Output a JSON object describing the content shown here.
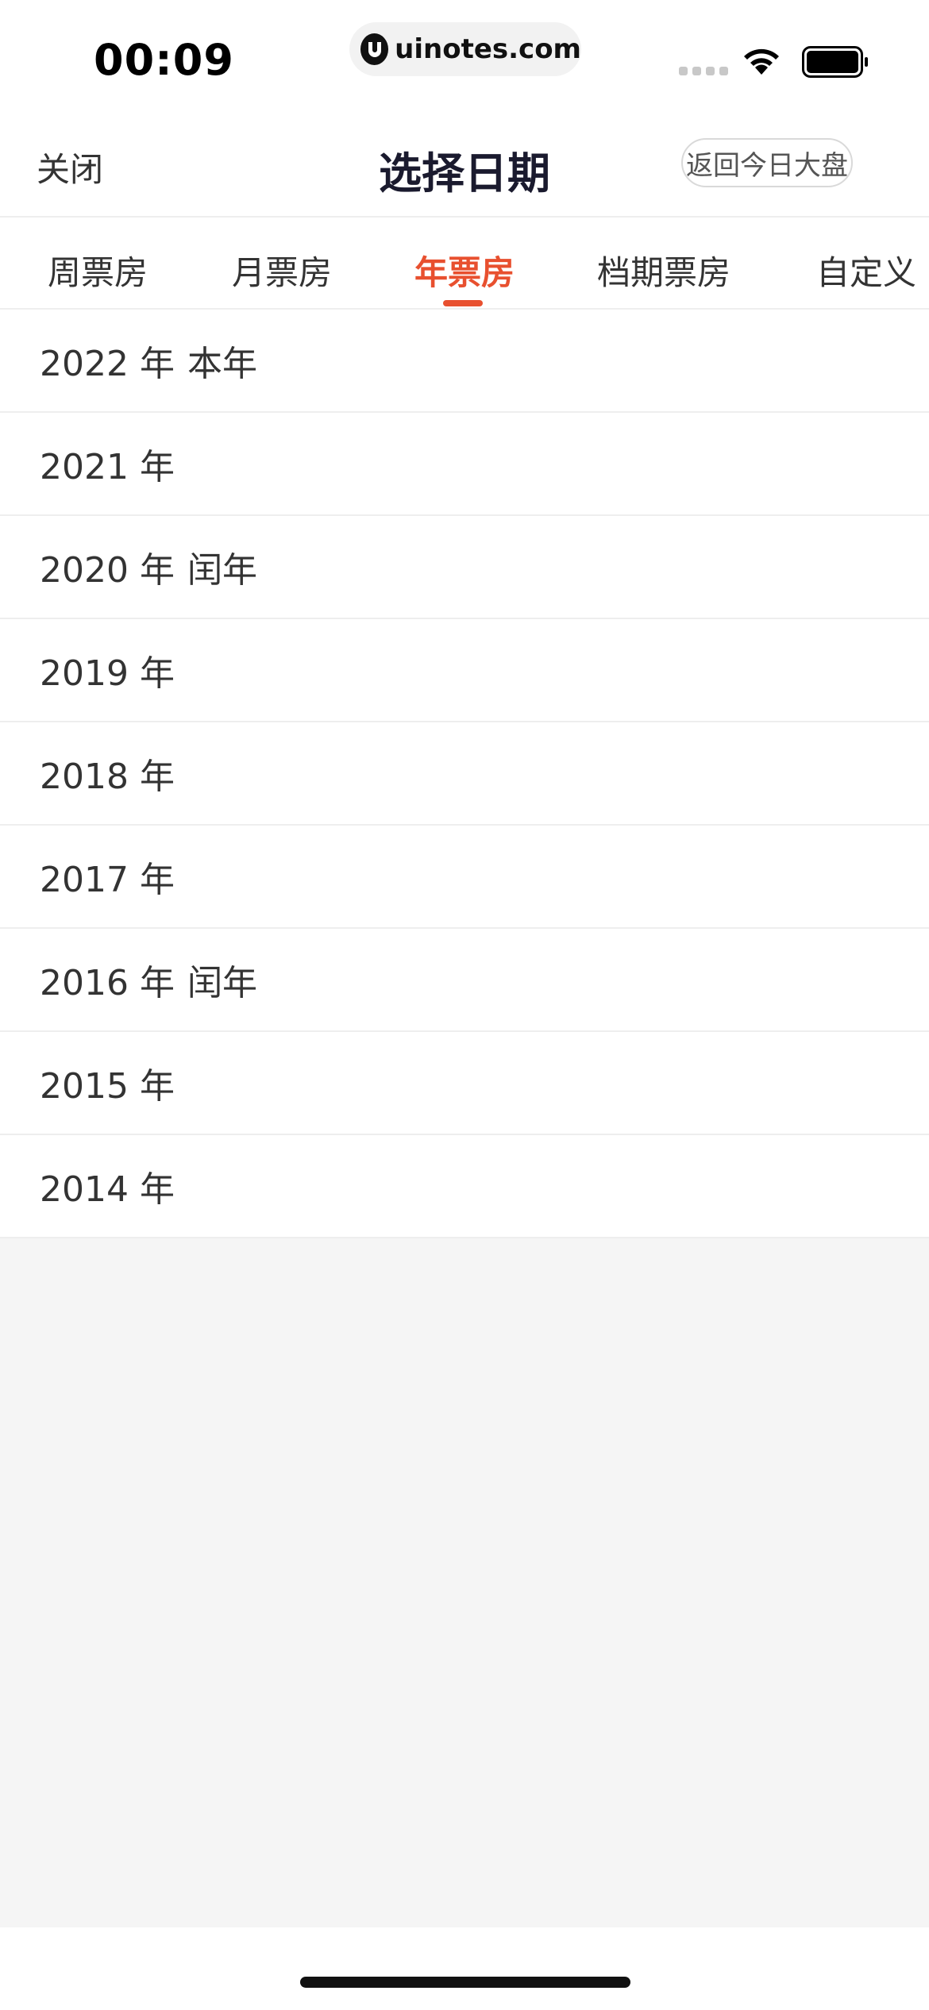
{
  "status_bar": {
    "time": "00:09",
    "url": "uinotes.com"
  },
  "nav": {
    "close_label": "关闭",
    "title": "选择日期",
    "return_label": "返回今日大盘"
  },
  "tabs": [
    {
      "label": "周票房"
    },
    {
      "label": "月票房"
    },
    {
      "label": "年票房"
    },
    {
      "label": "档期票房"
    },
    {
      "label": "自定义"
    }
  ],
  "active_tab": "年票房",
  "years": [
    {
      "label": "2022 年",
      "tag": "本年"
    },
    {
      "label": "2021 年",
      "tag": ""
    },
    {
      "label": "2020 年",
      "tag": "闰年"
    },
    {
      "label": "2019 年",
      "tag": ""
    },
    {
      "label": "2018 年",
      "tag": ""
    },
    {
      "label": "2017 年",
      "tag": ""
    },
    {
      "label": "2016 年",
      "tag": "闰年"
    },
    {
      "label": "2015 年",
      "tag": ""
    },
    {
      "label": "2014 年",
      "tag": ""
    }
  ],
  "colors": {
    "accent": "#e8502f",
    "text": "#333333",
    "title": "#1a1a2e",
    "background": "#f5f5f5"
  }
}
